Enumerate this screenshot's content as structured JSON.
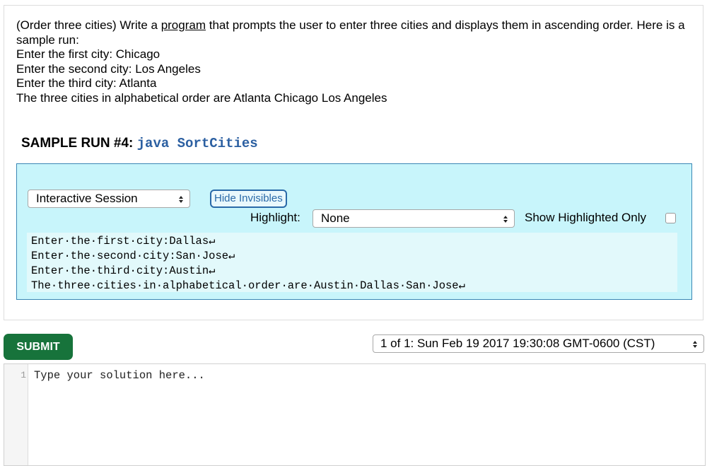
{
  "problem": {
    "intro_prefix": "(Order three cities) Write a ",
    "program_link": "program",
    "intro_suffix": " that prompts the user to enter three cities and displays them in ascending order. Here is a sample run:",
    "sample_lines": [
      "Enter the first city: Chicago",
      "Enter the second city: Los Angeles",
      "Enter the third city: Atlanta",
      "The three cities in alphabetical order are Atlanta Chicago Los Angeles"
    ]
  },
  "sample_run": {
    "heading": "SAMPLE RUN #4:",
    "command": "java SortCities"
  },
  "session": {
    "mode_select": "Interactive Session",
    "hide_invisibles_label": "Hide Invisibles",
    "highlight_label": "Highlight:",
    "highlight_value": "None",
    "show_highlighted_only_label": "Show Highlighted Only",
    "show_highlighted_only_checked": false,
    "output_lines": [
      "Enter·the·first·city:Dallas↵",
      "Enter·the·second·city:San·Jose↵",
      "Enter·the·third·city:Austin↵",
      "The·three·cities·in·alphabetical·order·are·Austin·Dallas·San·Jose↵"
    ]
  },
  "submit_label": "SUBMIT",
  "version_select": "1 of 1: Sun Feb 19 2017 19:30:08 GMT-0600 (CST)",
  "editor": {
    "line_number": "1",
    "placeholder": "Type your solution here..."
  },
  "colors": {
    "submit_bg": "#17733b",
    "session_bg": "#c8f5fb",
    "accent_blue": "#2a6aa8"
  },
  "icons": {
    "select_arrows": "updown-chevron-icon"
  }
}
